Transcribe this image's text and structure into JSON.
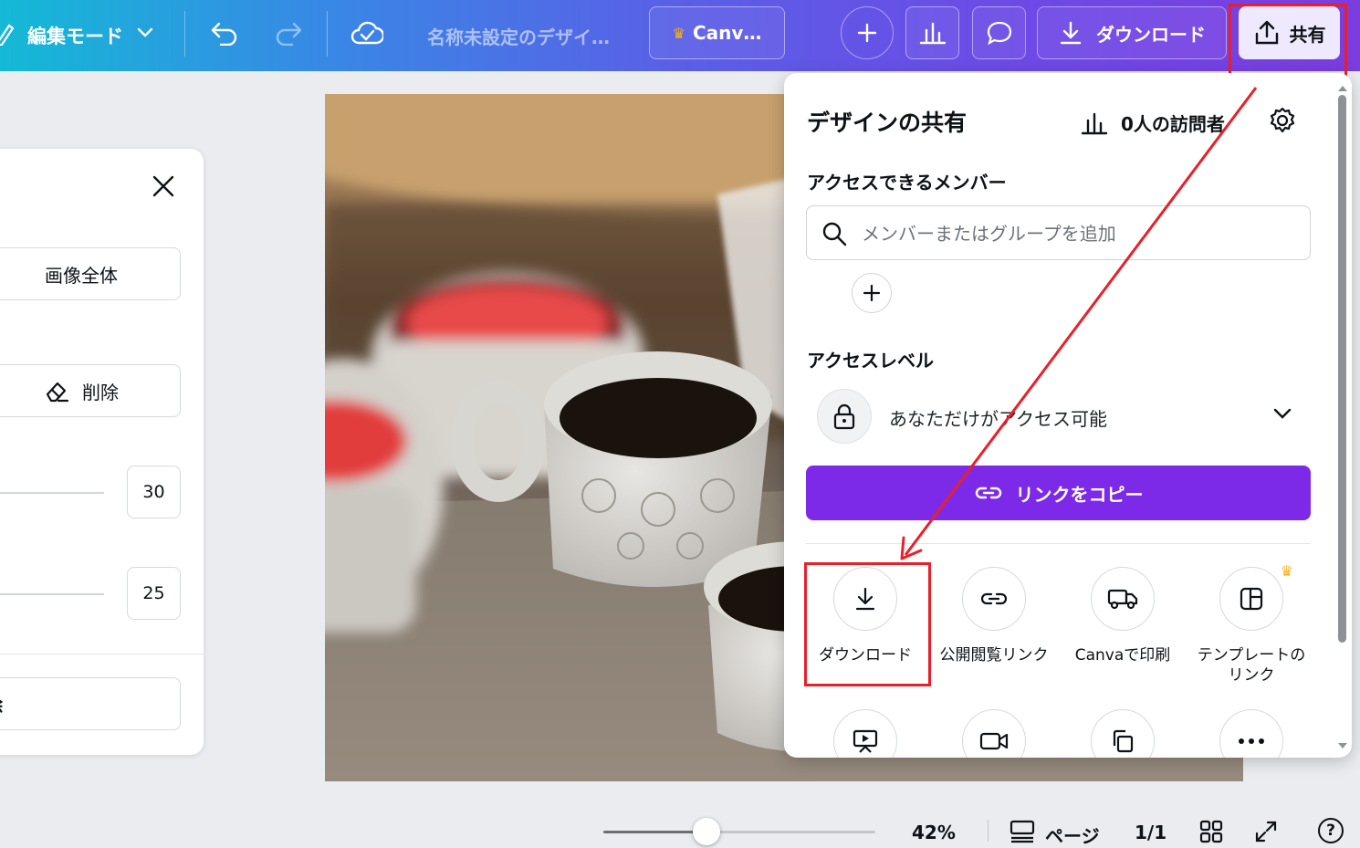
{
  "header": {
    "edit_mode_label": "編集モード",
    "design_title": "名称未設定のデザイ…",
    "canva_pro_label": "Canv…",
    "download_label": "ダウンロード",
    "share_label": "共有"
  },
  "left_panel": {
    "whole_image_label": "画像全体",
    "erase_label": "削除",
    "size_value": "30",
    "softness_value": "25",
    "bottom_button_label": "除"
  },
  "share_panel": {
    "title": "デザインの共有",
    "visitors_label": "0人の訪問者",
    "access_members_heading": "アクセスできるメンバー",
    "search_placeholder": "メンバーまたはグループを追加",
    "access_level_heading": "アクセスレベル",
    "access_level_value": "あなただけがアクセス可能",
    "copy_link_label": "リンクをコピー",
    "options": [
      {
        "label": "ダウンロード",
        "icon": "download-icon"
      },
      {
        "label": "公開閲覧リンク",
        "icon": "link-icon"
      },
      {
        "label": "Canvaで印刷",
        "icon": "truck-icon"
      },
      {
        "label": "テンプレートの\nリンク",
        "icon": "template-icon"
      }
    ]
  },
  "bottom_bar": {
    "zoom_percent": "42%",
    "zoom_fraction": 0.38,
    "pages_label": "ページ",
    "page_count": "1/1",
    "help_label": "?"
  },
  "colors": {
    "accent_purple": "#7d2ae8",
    "highlight_red": "#e8202a",
    "share_button_bg": "#efe9fd"
  }
}
